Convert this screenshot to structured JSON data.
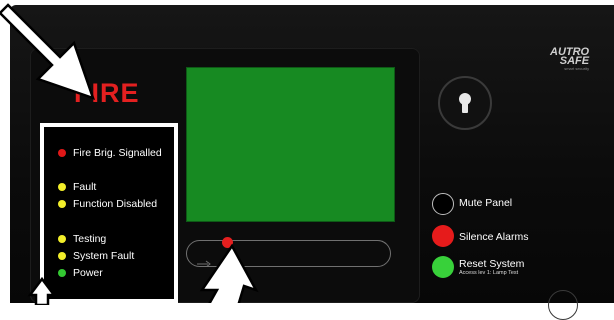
{
  "panel": {
    "alarm_title": "FIRE",
    "brand_line1": "AUTRO",
    "brand_line2": "SAFE",
    "brand_tagline": "smart security"
  },
  "indicators": [
    {
      "label": "Fire Brig. Signalled",
      "color": "#e01818"
    },
    {
      "label": "Fault",
      "color": "#f2ee2a"
    },
    {
      "label": "Function Disabled",
      "color": "#f2ee2a"
    },
    {
      "label": "Testing",
      "color": "#f2ee2a"
    },
    {
      "label": "System Fault",
      "color": "#f2ee2a"
    },
    {
      "label": "Power",
      "color": "#33c832"
    }
  ],
  "controls": {
    "mute_label": "Mute Panel",
    "silence_label": "Silence Alarms",
    "reset_label": "Reset System",
    "reset_sublabel": "Access lev 1: Lamp Test"
  },
  "colors": {
    "alarm_red": "#e32020",
    "display_green": "#178a22",
    "reset_green": "#38d13a",
    "silence_red": "#e61b1b"
  }
}
